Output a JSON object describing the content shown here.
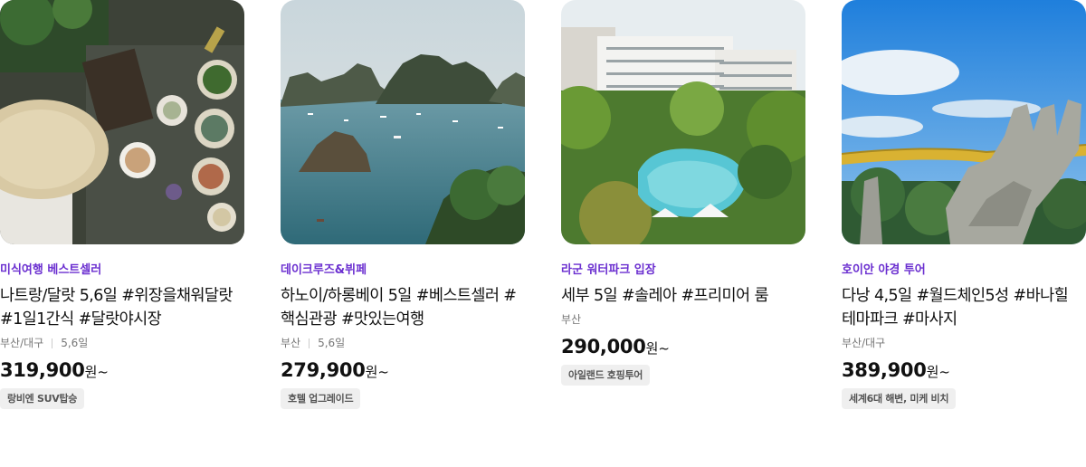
{
  "products": [
    {
      "label": "미식여행 베스트셀러",
      "title": "나트랑/달랏 5,6일 #위장을채워달랏 #1일1간식 #달랏야시장",
      "departure": "부산/대구",
      "duration": "5,6일",
      "price": "319,900",
      "price_unit": "원~",
      "badge": "랑비엔 SUV탑승",
      "image_icon": "food-table-photo"
    },
    {
      "label": "데이크루즈&뷔페",
      "title": "하노이/하롱베이 5일 #베스트셀러 #핵심관광 #맛있는여행",
      "departure": "부산",
      "duration": "5,6일",
      "price": "279,900",
      "price_unit": "원~",
      "badge": "호텔 업그레이드",
      "image_icon": "halong-bay-photo"
    },
    {
      "label": "라군 워터파크 입장",
      "title": "세부 5일 #솔레아 #프리미어 룸",
      "departure": "부산",
      "duration": "",
      "price": "290,000",
      "price_unit": "원~",
      "badge": "아일랜드 호핑투어",
      "image_icon": "resort-pool-photo"
    },
    {
      "label": "호이안 야경 투어",
      "title": "다낭 4,5일 #월드체인5성 #바나힐 테마파크 #마사지",
      "departure": "부산/대구",
      "duration": "",
      "price": "389,900",
      "price_unit": "원~",
      "badge": "세계6대 해변, 미케 비치",
      "image_icon": "golden-bridge-photo"
    }
  ],
  "colors": {
    "accent": "#6b2fd0",
    "badge_bg": "#efefef",
    "meta_text": "#777777"
  }
}
